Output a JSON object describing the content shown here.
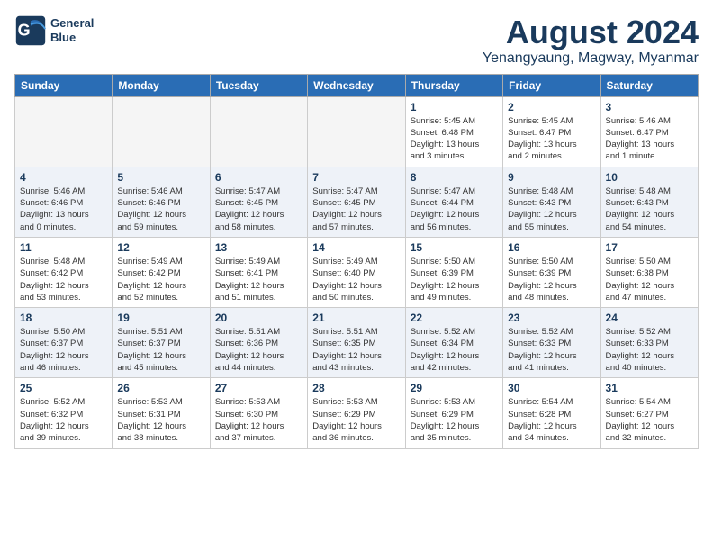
{
  "logo": {
    "line1": "General",
    "line2": "Blue"
  },
  "title": "August 2024",
  "subtitle": "Yenangyaung, Magway, Myanmar",
  "weekdays": [
    "Sunday",
    "Monday",
    "Tuesday",
    "Wednesday",
    "Thursday",
    "Friday",
    "Saturday"
  ],
  "weeks": [
    [
      {
        "day": "",
        "empty": true
      },
      {
        "day": "",
        "empty": true
      },
      {
        "day": "",
        "empty": true
      },
      {
        "day": "",
        "empty": true
      },
      {
        "day": "1",
        "empty": false,
        "info": "Sunrise: 5:45 AM\nSunset: 6:48 PM\nDaylight: 13 hours\nand 3 minutes."
      },
      {
        "day": "2",
        "empty": false,
        "info": "Sunrise: 5:45 AM\nSunset: 6:47 PM\nDaylight: 13 hours\nand 2 minutes."
      },
      {
        "day": "3",
        "empty": false,
        "info": "Sunrise: 5:46 AM\nSunset: 6:47 PM\nDaylight: 13 hours\nand 1 minute."
      }
    ],
    [
      {
        "day": "4",
        "empty": false,
        "info": "Sunrise: 5:46 AM\nSunset: 6:46 PM\nDaylight: 13 hours\nand 0 minutes."
      },
      {
        "day": "5",
        "empty": false,
        "info": "Sunrise: 5:46 AM\nSunset: 6:46 PM\nDaylight: 12 hours\nand 59 minutes."
      },
      {
        "day": "6",
        "empty": false,
        "info": "Sunrise: 5:47 AM\nSunset: 6:45 PM\nDaylight: 12 hours\nand 58 minutes."
      },
      {
        "day": "7",
        "empty": false,
        "info": "Sunrise: 5:47 AM\nSunset: 6:45 PM\nDaylight: 12 hours\nand 57 minutes."
      },
      {
        "day": "8",
        "empty": false,
        "info": "Sunrise: 5:47 AM\nSunset: 6:44 PM\nDaylight: 12 hours\nand 56 minutes."
      },
      {
        "day": "9",
        "empty": false,
        "info": "Sunrise: 5:48 AM\nSunset: 6:43 PM\nDaylight: 12 hours\nand 55 minutes."
      },
      {
        "day": "10",
        "empty": false,
        "info": "Sunrise: 5:48 AM\nSunset: 6:43 PM\nDaylight: 12 hours\nand 54 minutes."
      }
    ],
    [
      {
        "day": "11",
        "empty": false,
        "info": "Sunrise: 5:48 AM\nSunset: 6:42 PM\nDaylight: 12 hours\nand 53 minutes."
      },
      {
        "day": "12",
        "empty": false,
        "info": "Sunrise: 5:49 AM\nSunset: 6:42 PM\nDaylight: 12 hours\nand 52 minutes."
      },
      {
        "day": "13",
        "empty": false,
        "info": "Sunrise: 5:49 AM\nSunset: 6:41 PM\nDaylight: 12 hours\nand 51 minutes."
      },
      {
        "day": "14",
        "empty": false,
        "info": "Sunrise: 5:49 AM\nSunset: 6:40 PM\nDaylight: 12 hours\nand 50 minutes."
      },
      {
        "day": "15",
        "empty": false,
        "info": "Sunrise: 5:50 AM\nSunset: 6:39 PM\nDaylight: 12 hours\nand 49 minutes."
      },
      {
        "day": "16",
        "empty": false,
        "info": "Sunrise: 5:50 AM\nSunset: 6:39 PM\nDaylight: 12 hours\nand 48 minutes."
      },
      {
        "day": "17",
        "empty": false,
        "info": "Sunrise: 5:50 AM\nSunset: 6:38 PM\nDaylight: 12 hours\nand 47 minutes."
      }
    ],
    [
      {
        "day": "18",
        "empty": false,
        "info": "Sunrise: 5:50 AM\nSunset: 6:37 PM\nDaylight: 12 hours\nand 46 minutes."
      },
      {
        "day": "19",
        "empty": false,
        "info": "Sunrise: 5:51 AM\nSunset: 6:37 PM\nDaylight: 12 hours\nand 45 minutes."
      },
      {
        "day": "20",
        "empty": false,
        "info": "Sunrise: 5:51 AM\nSunset: 6:36 PM\nDaylight: 12 hours\nand 44 minutes."
      },
      {
        "day": "21",
        "empty": false,
        "info": "Sunrise: 5:51 AM\nSunset: 6:35 PM\nDaylight: 12 hours\nand 43 minutes."
      },
      {
        "day": "22",
        "empty": false,
        "info": "Sunrise: 5:52 AM\nSunset: 6:34 PM\nDaylight: 12 hours\nand 42 minutes."
      },
      {
        "day": "23",
        "empty": false,
        "info": "Sunrise: 5:52 AM\nSunset: 6:33 PM\nDaylight: 12 hours\nand 41 minutes."
      },
      {
        "day": "24",
        "empty": false,
        "info": "Sunrise: 5:52 AM\nSunset: 6:33 PM\nDaylight: 12 hours\nand 40 minutes."
      }
    ],
    [
      {
        "day": "25",
        "empty": false,
        "info": "Sunrise: 5:52 AM\nSunset: 6:32 PM\nDaylight: 12 hours\nand 39 minutes."
      },
      {
        "day": "26",
        "empty": false,
        "info": "Sunrise: 5:53 AM\nSunset: 6:31 PM\nDaylight: 12 hours\nand 38 minutes."
      },
      {
        "day": "27",
        "empty": false,
        "info": "Sunrise: 5:53 AM\nSunset: 6:30 PM\nDaylight: 12 hours\nand 37 minutes."
      },
      {
        "day": "28",
        "empty": false,
        "info": "Sunrise: 5:53 AM\nSunset: 6:29 PM\nDaylight: 12 hours\nand 36 minutes."
      },
      {
        "day": "29",
        "empty": false,
        "info": "Sunrise: 5:53 AM\nSunset: 6:29 PM\nDaylight: 12 hours\nand 35 minutes."
      },
      {
        "day": "30",
        "empty": false,
        "info": "Sunrise: 5:54 AM\nSunset: 6:28 PM\nDaylight: 12 hours\nand 34 minutes."
      },
      {
        "day": "31",
        "empty": false,
        "info": "Sunrise: 5:54 AM\nSunset: 6:27 PM\nDaylight: 12 hours\nand 32 minutes."
      }
    ]
  ]
}
